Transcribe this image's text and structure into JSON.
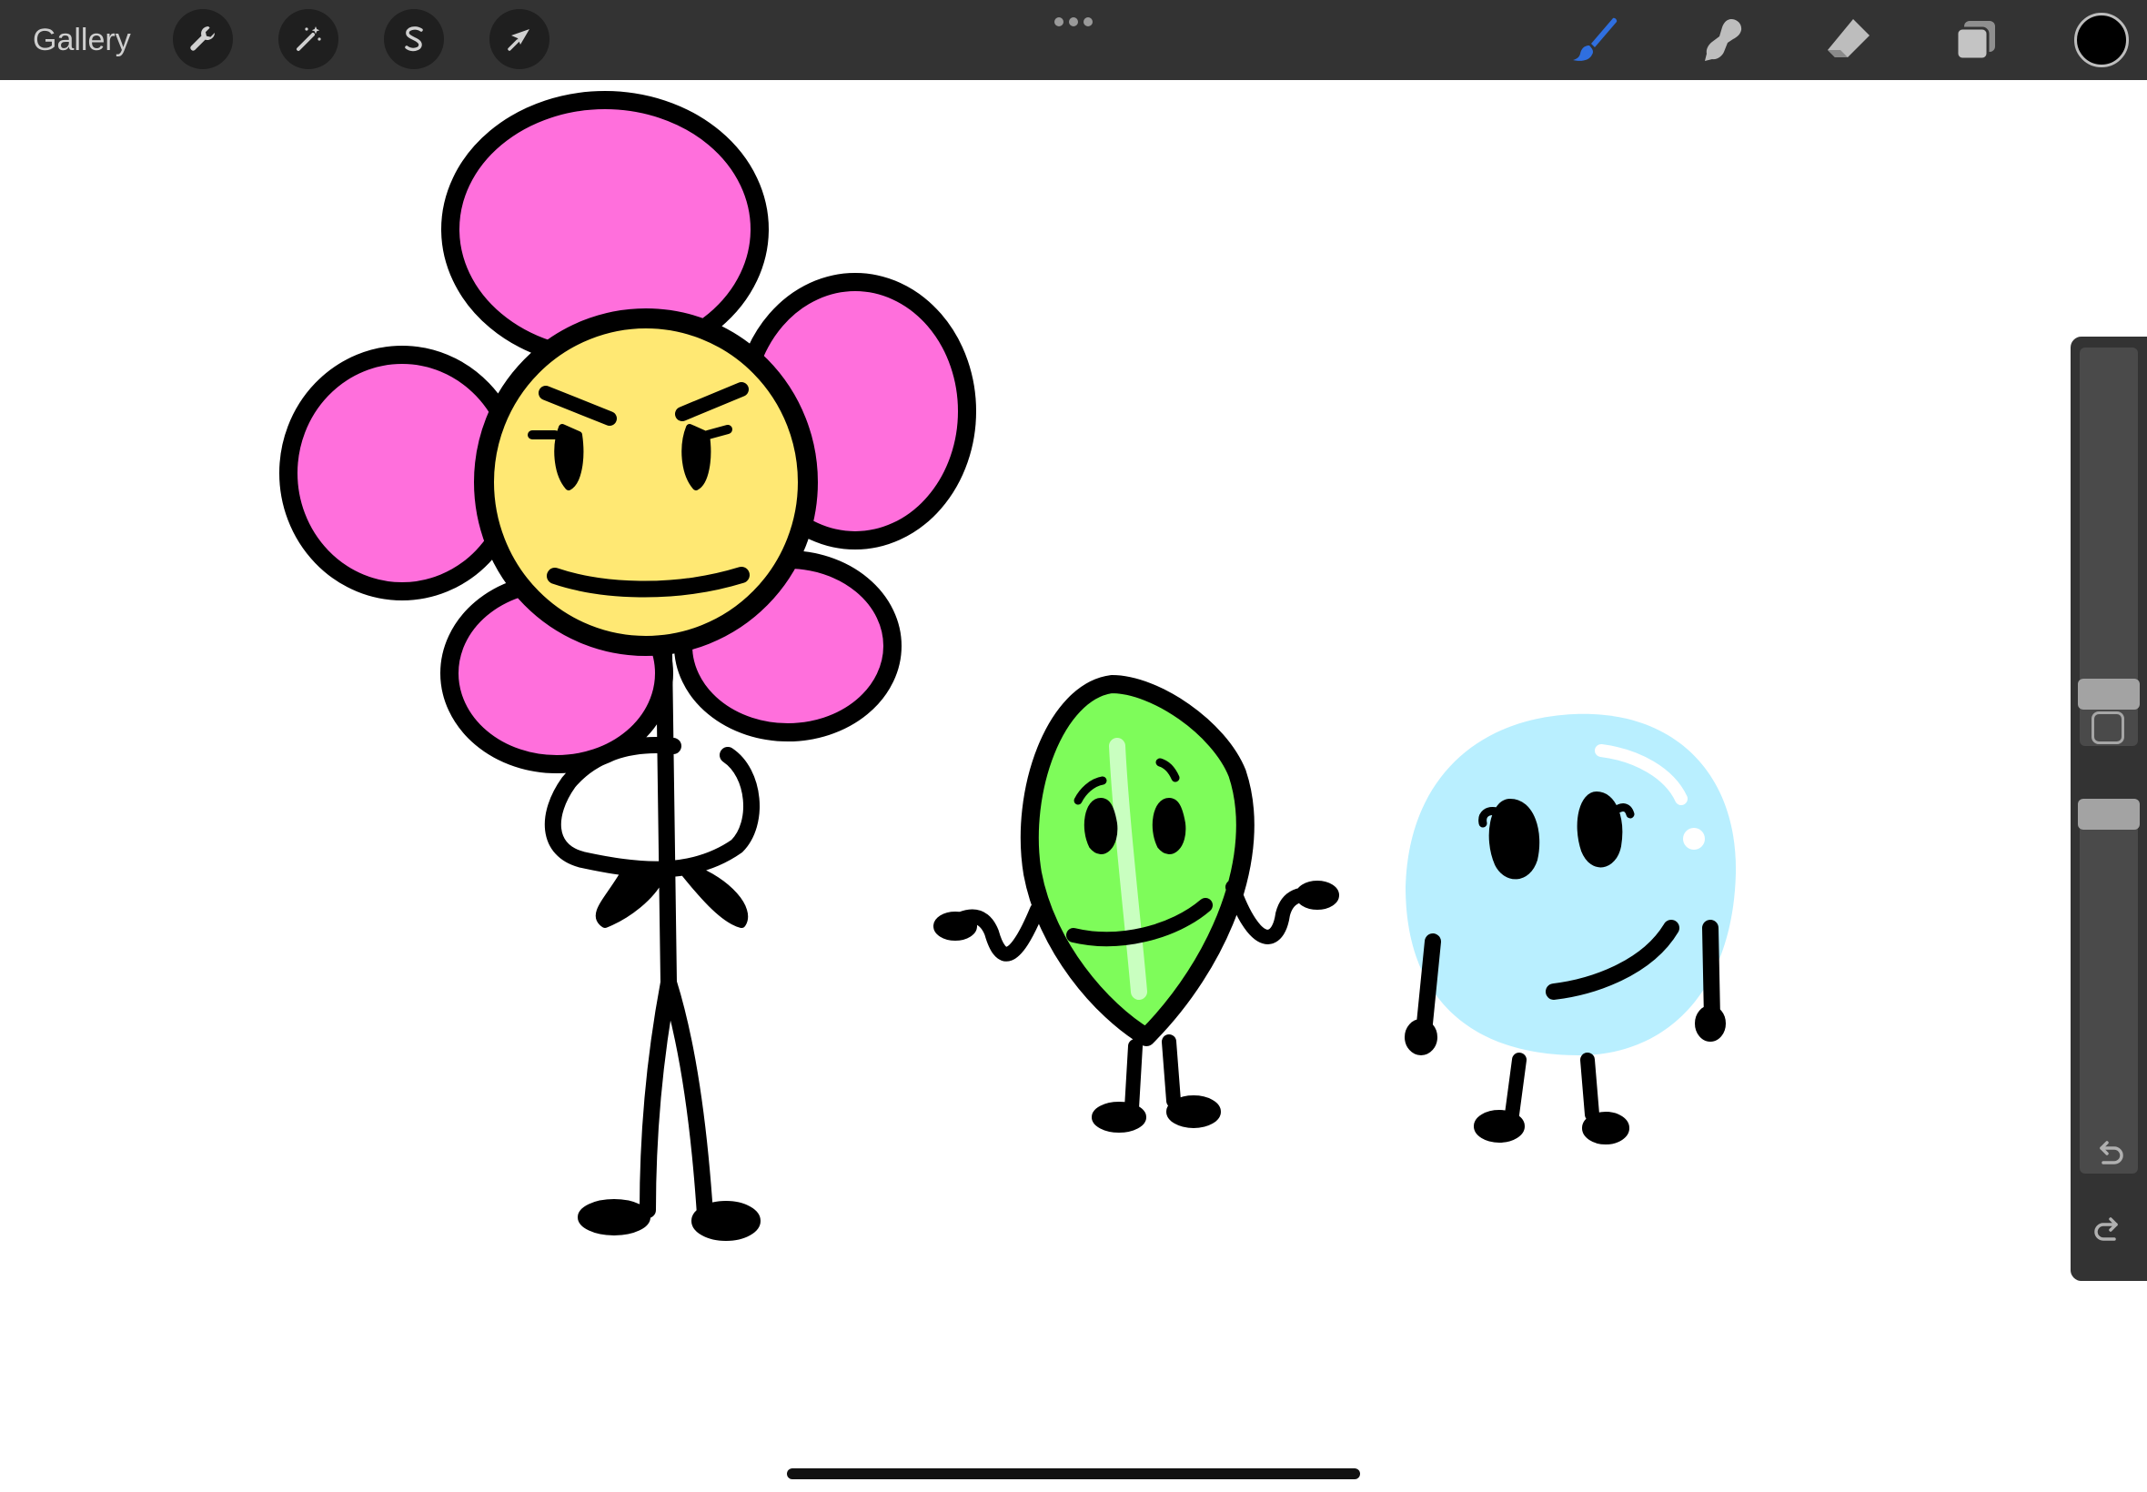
{
  "app": {
    "gallery_label": "Gallery"
  },
  "toolbar_left": [
    {
      "name": "actions-button",
      "icon": "wrench-icon"
    },
    {
      "name": "adjustments-button",
      "icon": "magic-wand-icon"
    },
    {
      "name": "selection-button",
      "icon": "selection-s-icon"
    },
    {
      "name": "transform-button",
      "icon": "arrow-cursor-icon"
    }
  ],
  "toolbar_right": [
    {
      "name": "brush-button",
      "icon": "brush-icon",
      "active": true
    },
    {
      "name": "smudge-button",
      "icon": "smudge-finger-icon",
      "active": false
    },
    {
      "name": "eraser-button",
      "icon": "eraser-icon",
      "active": false
    },
    {
      "name": "layers-button",
      "icon": "layers-icon",
      "active": false
    }
  ],
  "colors": {
    "toolbar_bg": "#333333",
    "active_tool": "#2f6fe0",
    "inactive_tool": "#bdbdbd",
    "current_color": "#000000",
    "petal": "#ff6fdc",
    "face_yellow": "#ffe873",
    "leaf_green": "#7efc5a",
    "bubble_blue": "#b9efff",
    "outline": "#000000"
  },
  "sidebar": {
    "brush_size_level": 0.9,
    "opacity_level": 0.0,
    "icons": [
      "modify-square-icon",
      "undo-icon",
      "redo-icon"
    ]
  },
  "canvas": {
    "characters": [
      "flower-character",
      "leafy-character",
      "bubble-character"
    ]
  }
}
